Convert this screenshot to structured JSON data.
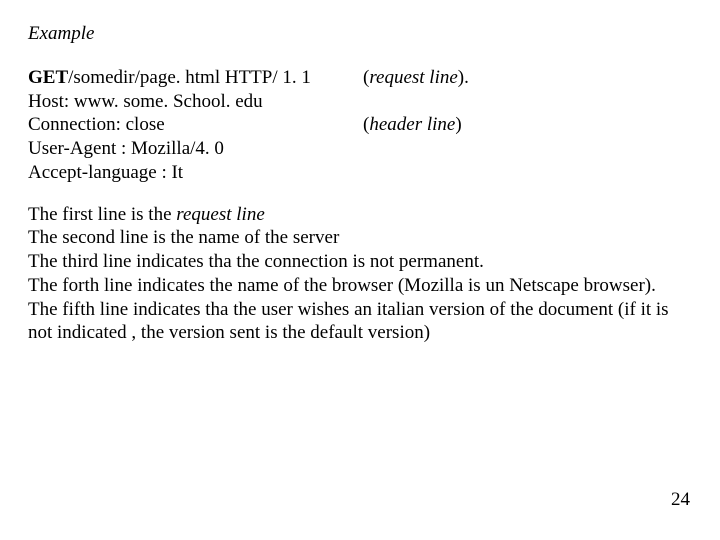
{
  "heading": "Example",
  "request": {
    "lines": [
      {
        "left_bold": "GET",
        "left_rest": "/somedir/page. html  HTTP/ 1. 1",
        "right_prefix": " (",
        "right_italic": "request line",
        "right_suffix": ")."
      },
      {
        "left_bold": "",
        "left_rest": "Host: www. some. School. edu",
        "right_prefix": "",
        "right_italic": "",
        "right_suffix": ""
      },
      {
        "left_bold": "",
        "left_rest": "Connection: close",
        "right_prefix": "(",
        "right_italic": "header line",
        "right_suffix": ")"
      },
      {
        "left_bold": "",
        "left_rest": "User-Agent : Mozilla/4. 0",
        "right_prefix": "",
        "right_italic": "",
        "right_suffix": ""
      },
      {
        "left_bold": "",
        "left_rest": "Accept-language : It",
        "right_prefix": "",
        "right_italic": "",
        "right_suffix": ""
      }
    ]
  },
  "description": {
    "line1_prefix": "The first line is the ",
    "line1_italic": "request line",
    "line2": "The second line is the name of the server",
    "line3": "The third line indicates tha the connection is not permanent.",
    "line4": "The forth line indicates the name of the browser (Mozilla is un Netscape browser).",
    "line5": " The fifth line indicates tha the user wishes an italian version of the document (if it is not indicated , the version sent is the default version)"
  },
  "page_number": "24"
}
